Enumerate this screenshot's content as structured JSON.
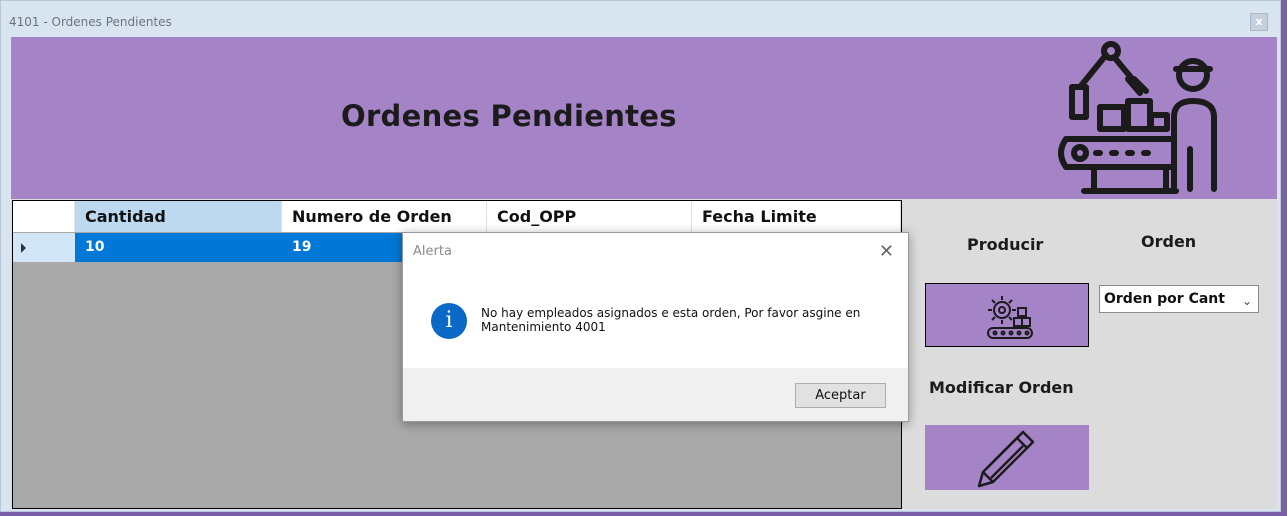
{
  "window": {
    "title": "4101 - Ordenes Pendientes",
    "close_label": "x"
  },
  "header": {
    "title": "Ordenes Pendientes",
    "icon": "factory-worker-conveyor-icon"
  },
  "grid": {
    "columns": [
      "Cantidad",
      "Numero de Orden",
      "Cod_OPP",
      "Fecha Limite"
    ],
    "rows": [
      {
        "cantidad": "10",
        "numero_orden": "19"
      }
    ]
  },
  "side": {
    "producir_label": "Producir",
    "orden_label": "Orden",
    "orden_select_value": "Orden por Cant",
    "modificar_label": "Modificar Orden",
    "producir_icon": "gear-boxes-conveyor-icon",
    "modificar_icon": "pencil-icon"
  },
  "dialog": {
    "title": "Alerta",
    "message": "No hay empleados asignados e esta orden, Por favor asgine en Mantenimiento 4001",
    "ok_label": "Aceptar",
    "icon": "info-icon"
  },
  "colors": {
    "accent_purple": "#a583c7",
    "selection_blue": "#0078d7",
    "grid_bg": "#a9a9a9"
  }
}
